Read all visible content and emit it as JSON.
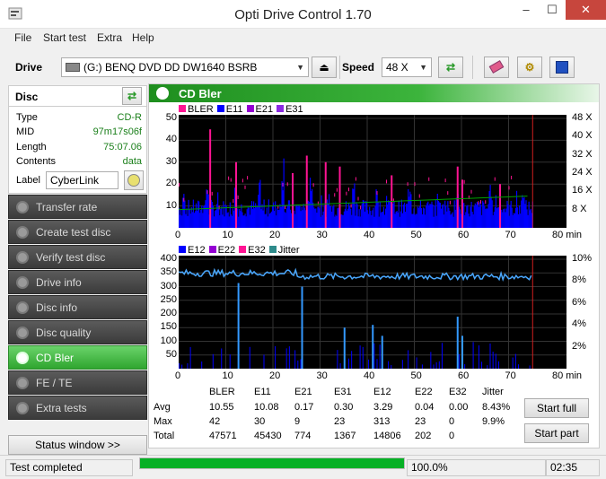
{
  "window": {
    "title": "Opti Drive Control 1.70",
    "min_label": "–",
    "max_label": "☐",
    "close_label": "✕"
  },
  "menu": [
    "File",
    "Start test",
    "Extra",
    "Help"
  ],
  "toolbar": {
    "drive_label": "Drive",
    "drive_value": "(G:)  BENQ DVD DD DW1640 BSRB",
    "speed_label": "Speed",
    "speed_value": "48 X",
    "icons": [
      "eject-icon",
      "refresh-icon",
      "erase-icon",
      "settings-icon",
      "save-icon"
    ]
  },
  "disc": {
    "header": "Disc",
    "fields": [
      {
        "key": "Type",
        "value": "CD-R"
      },
      {
        "key": "MID",
        "value": "97m17s06f"
      },
      {
        "key": "Length",
        "value": "75:07.06"
      },
      {
        "key": "Contents",
        "value": "data"
      }
    ],
    "label_key": "Label",
    "label_value": "CyberLink"
  },
  "nav": [
    {
      "label": "Transfer rate",
      "active": false
    },
    {
      "label": "Create test disc",
      "active": false
    },
    {
      "label": "Verify test disc",
      "active": false
    },
    {
      "label": "Drive info",
      "active": false
    },
    {
      "label": "Disc info",
      "active": false
    },
    {
      "label": "Disc quality",
      "active": false
    },
    {
      "label": "CD Bler",
      "active": true
    },
    {
      "label": "FE / TE",
      "active": false
    },
    {
      "label": "Extra tests",
      "active": false
    }
  ],
  "status_window_label": "Status window >>",
  "panel_title": "CD Bler",
  "chart_data": [
    {
      "type": "bar",
      "title": "BLER / E11 / E21 / E31",
      "legend": [
        {
          "name": "BLER",
          "color": "#ff1493"
        },
        {
          "name": "E11",
          "color": "#0000ff"
        },
        {
          "name": "E21",
          "color": "#9400d3"
        },
        {
          "name": "E31",
          "color": "#8a2be2"
        }
      ],
      "x_ticks": [
        "0",
        "10",
        "20",
        "30",
        "40",
        "50",
        "60",
        "70",
        "80 min"
      ],
      "y_ticks_left": [
        "10",
        "20",
        "30",
        "40",
        "50"
      ],
      "y_ticks_right": [
        "8 X",
        "16 X",
        "24 X",
        "32 X",
        "40 X",
        "48 X"
      ],
      "xlim": [
        0,
        80
      ],
      "ylim": [
        0,
        50
      ],
      "end_marker_min": 75.1,
      "series_summary": {
        "E11_typical": 10,
        "E11_peaks": [
          [
            1,
            18
          ],
          [
            6,
            22
          ],
          [
            12,
            20
          ],
          [
            17,
            24
          ],
          [
            22,
            28
          ],
          [
            28,
            24
          ],
          [
            37,
            26
          ],
          [
            42,
            18
          ],
          [
            49,
            22
          ],
          [
            55,
            18
          ],
          [
            59,
            20
          ],
          [
            66,
            18
          ],
          [
            73,
            16
          ]
        ],
        "BLER_peaks": [
          [
            6.5,
            45
          ],
          [
            12,
            30
          ],
          [
            24,
            25
          ],
          [
            27,
            33
          ],
          [
            31,
            30
          ],
          [
            34,
            28
          ],
          [
            45,
            24
          ],
          [
            59,
            28
          ],
          [
            60,
            22
          ],
          [
            68,
            20
          ]
        ]
      },
      "speed_curve": {
        "unit": "X",
        "start": 8,
        "end": 14
      }
    },
    {
      "type": "bar",
      "title": "E12 / E22 / E32 / Jitter",
      "legend": [
        {
          "name": "E12",
          "color": "#0000ff"
        },
        {
          "name": "E22",
          "color": "#9400d3"
        },
        {
          "name": "E32",
          "color": "#ff1493"
        },
        {
          "name": "Jitter",
          "color": "#2e8b8b"
        }
      ],
      "x_ticks": [
        "0",
        "10",
        "20",
        "30",
        "40",
        "50",
        "60",
        "70",
        "80 min"
      ],
      "y_ticks_left": [
        "50",
        "100",
        "150",
        "200",
        "250",
        "300",
        "350",
        "400"
      ],
      "y_ticks_right": [
        "2%",
        "4%",
        "6%",
        "8%",
        "10%"
      ],
      "xlim": [
        0,
        80
      ],
      "ylim": [
        0,
        400
      ],
      "y2lim": [
        0,
        10
      ],
      "end_marker_min": 75.1,
      "jitter_avg_pct": 8.43,
      "e12_spikes": [
        [
          12.5,
          313
        ],
        [
          26,
          300
        ],
        [
          35,
          150
        ],
        [
          41,
          160
        ],
        [
          43,
          120
        ],
        [
          59,
          190
        ],
        [
          60,
          120
        ]
      ]
    }
  ],
  "stats": {
    "headers": [
      "",
      "BLER",
      "E11",
      "E21",
      "E31",
      "E12",
      "E22",
      "E32",
      "Jitter"
    ],
    "rows": [
      [
        "Avg",
        "10.55",
        "10.08",
        "0.17",
        "0.30",
        "3.29",
        "0.04",
        "0.00",
        "8.43%"
      ],
      [
        "Max",
        "42",
        "30",
        "9",
        "23",
        "313",
        "23",
        "0",
        "9.9%"
      ],
      [
        "Total",
        "47571",
        "45430",
        "774",
        "1367",
        "14806",
        "202",
        "0",
        ""
      ]
    ]
  },
  "buttons": {
    "start_full": "Start full",
    "start_part": "Start part"
  },
  "statusbar": {
    "status": "Test completed",
    "progress_pct": 100.0,
    "progress_label": "100.0%",
    "time": "02:35"
  }
}
